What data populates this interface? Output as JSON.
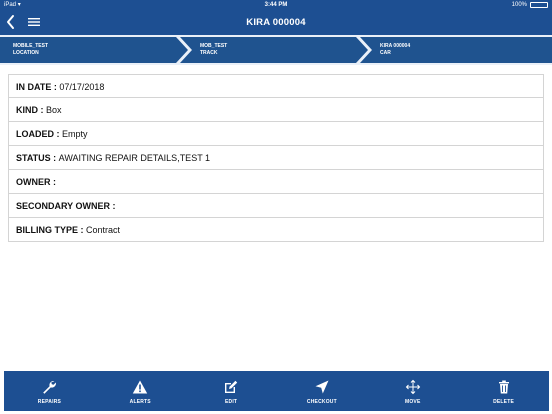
{
  "status_bar": {
    "device": "iPad",
    "time": "3:44 PM",
    "battery": "100%"
  },
  "nav": {
    "title": "KIRA 000004"
  },
  "breadcrumb": [
    {
      "name": "MOBILE_TEST",
      "type": "LOCATION"
    },
    {
      "name": "MOB_TEST",
      "type": "TRACK"
    },
    {
      "name": "KIRA 000004",
      "type": "CAR"
    }
  ],
  "details": [
    {
      "label": "IN DATE",
      "sep": " : ",
      "value": "07/17/2018"
    },
    {
      "label": "KIND",
      "sep": " : ",
      "value": "Box"
    },
    {
      "label": "LOADED",
      "sep": " : ",
      "value": "Empty"
    },
    {
      "label": "STATUS",
      "sep": " : ",
      "value": "AWAITING REPAIR DETAILS,TEST 1"
    },
    {
      "label": "OWNER",
      "sep": " :",
      "value": ""
    },
    {
      "label": "SECONDARY OWNER",
      "sep": " :",
      "value": ""
    },
    {
      "label": "BILLING TYPE",
      "sep": " : ",
      "value": "Contract"
    }
  ],
  "toolbar": [
    {
      "label": "REPAIRS",
      "icon": "wrench-icon"
    },
    {
      "label": "ALERTS",
      "icon": "warning-icon"
    },
    {
      "label": "EDIT",
      "icon": "edit-icon"
    },
    {
      "label": "CHECKOUT",
      "icon": "send-icon"
    },
    {
      "label": "MOVE",
      "icon": "move-icon"
    },
    {
      "label": "DELETE",
      "icon": "trash-icon"
    }
  ],
  "colors": {
    "brand": "#1d4f92",
    "breadcrumb_bg": "#1f538f",
    "border": "#d4d4d4"
  }
}
